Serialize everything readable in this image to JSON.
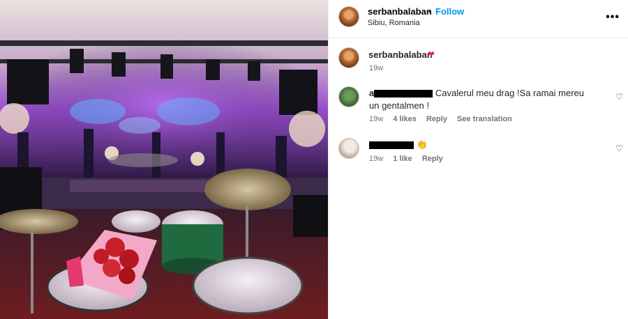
{
  "header": {
    "username": "serbanbalaban",
    "separator": "•",
    "follow_label": "Follow",
    "location": "Sibiu, Romania",
    "more_icon": "•••"
  },
  "caption": {
    "username": "serbanbalaban",
    "emoji": "❤",
    "age": "19w"
  },
  "comments": [
    {
      "username_prefix": "a",
      "text": "Cavalerul meu drag !Sa ramai mereu un gentalmen !",
      "age": "19w",
      "likes": "4 likes",
      "reply": "Reply",
      "translation": "See translation"
    },
    {
      "emoji": "👏",
      "age": "19w",
      "likes": "1 like",
      "reply": "Reply"
    }
  ],
  "like_icon": "♡",
  "colors": {
    "follow": "#0095f6",
    "secondary_text": "#737373",
    "border": "#efefef",
    "stage_purple": "#8a3cd6"
  }
}
